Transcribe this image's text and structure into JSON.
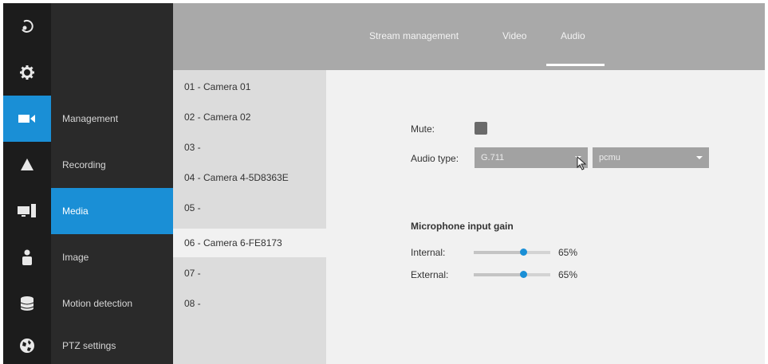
{
  "tabs": [
    {
      "label": "Stream management"
    },
    {
      "label": "Video"
    },
    {
      "label": "Audio"
    }
  ],
  "rail": [
    {
      "icon": "logout-icon"
    },
    {
      "icon": "gear-icon"
    },
    {
      "icon": "camera-icon"
    },
    {
      "icon": "alert-icon"
    },
    {
      "icon": "monitor-icon"
    },
    {
      "icon": "user-icon"
    },
    {
      "icon": "database-icon"
    },
    {
      "icon": "network-globe-icon"
    }
  ],
  "submenu": [
    {
      "label": "Management"
    },
    {
      "label": "Recording"
    },
    {
      "label": "Media"
    },
    {
      "label": "Image"
    },
    {
      "label": "Motion detection"
    },
    {
      "label": "PTZ settings"
    }
  ],
  "cameras": [
    {
      "label": "01 - Camera 01"
    },
    {
      "label": "02 - Camera 02"
    },
    {
      "label": "03 -"
    },
    {
      "label": "04 - Camera 4-5D8363E"
    },
    {
      "label": "05 -"
    },
    {
      "label": "06 - Camera 6-FE8173"
    },
    {
      "label": "07 -"
    },
    {
      "label": "08 -"
    }
  ],
  "audio": {
    "mute_label": "Mute:",
    "audio_type_label": "Audio type:",
    "codec_value": "G.711",
    "encoding_value": "pcmu",
    "gain_title": "Microphone input gain",
    "internal_label": "Internal:",
    "internal_value": "65%",
    "external_label": "External:",
    "external_value": "65%",
    "internal_gain": 0.65,
    "external_gain": 0.65
  },
  "colors": {
    "accent": "#1a8fd6",
    "rail_bg": "#1c1c1c",
    "submenu_bg": "#2a2a2a",
    "header_bg": "#a9a9a9"
  }
}
